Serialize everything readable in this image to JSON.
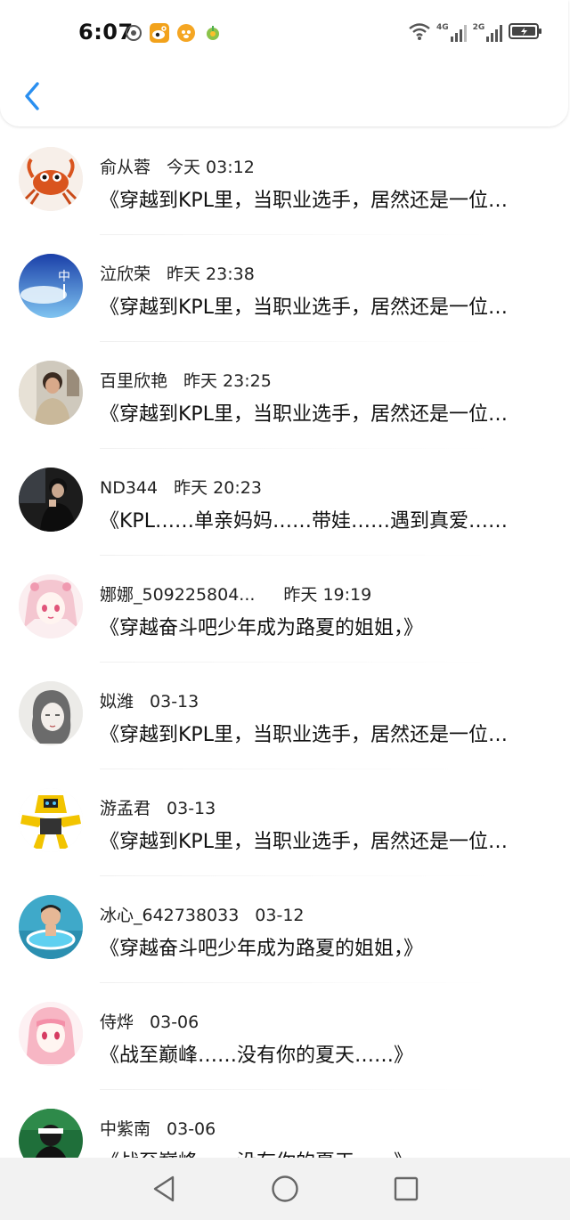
{
  "status_bar": {
    "time": "6:07",
    "left_icons": [
      "sync-app-icon",
      "weibo-icon",
      "fox-app-icon",
      "sprout-app-icon"
    ],
    "right_icons": [
      "wifi-icon",
      "signal-4g-icon",
      "signal-2g-icon",
      "battery-charging-icon"
    ],
    "net1": "4G",
    "net2": "2G"
  },
  "header": {
    "back_icon": "chevron-left-icon",
    "accent_color": "#2a8ff0"
  },
  "items": [
    {
      "name": "俞从蓉",
      "time": "今天 03:12",
      "title": "《穿越到KPL里，当职业选手，居然还是一位…",
      "avatar": "crab"
    },
    {
      "name": "泣欣荣",
      "time": "昨天 23:38",
      "title": "《穿越到KPL里，当职业选手，居然还是一位…",
      "avatar": "blue-art"
    },
    {
      "name": "百里欣艳",
      "time": "昨天 23:25",
      "title": "《穿越到KPL里，当职业选手，居然还是一位…",
      "avatar": "photo-woman"
    },
    {
      "name": "ND344",
      "time": "昨天 20:23",
      "title": "《KPL……单亲妈妈……带娃……遇到真爱……",
      "avatar": "dark-photo"
    },
    {
      "name": "娜娜_509225804...",
      "time": "昨天 19:19",
      "title": "《穿越奋斗吧少年成为路夏的姐姐，》",
      "avatar": "anime-pink"
    },
    {
      "name": "姒潍",
      "time": "03-13",
      "title": "《穿越到KPL里，当职业选手，居然还是一位…",
      "avatar": "sketch-girl"
    },
    {
      "name": "游孟君",
      "time": "03-13",
      "title": "《穿越到KPL里，当职业选手，居然还是一位…",
      "avatar": "yellow-robot"
    },
    {
      "name": "冰心_642738033",
      "time": "03-12",
      "title": "《穿越奋斗吧少年成为路夏的姐姐，》",
      "avatar": "kid-pool"
    },
    {
      "name": "侍烨",
      "time": "03-06",
      "title": "《战至巅峰……没有你的夏天……》",
      "avatar": "anime-pink-2"
    },
    {
      "name": "中紫南",
      "time": "03-06",
      "title": "《战至巅峰……没有你的夏天……》",
      "avatar": "green-photo"
    }
  ],
  "nav_bar": {
    "back": "triangle-back-icon",
    "home": "circle-home-icon",
    "recents": "square-recents-icon"
  }
}
